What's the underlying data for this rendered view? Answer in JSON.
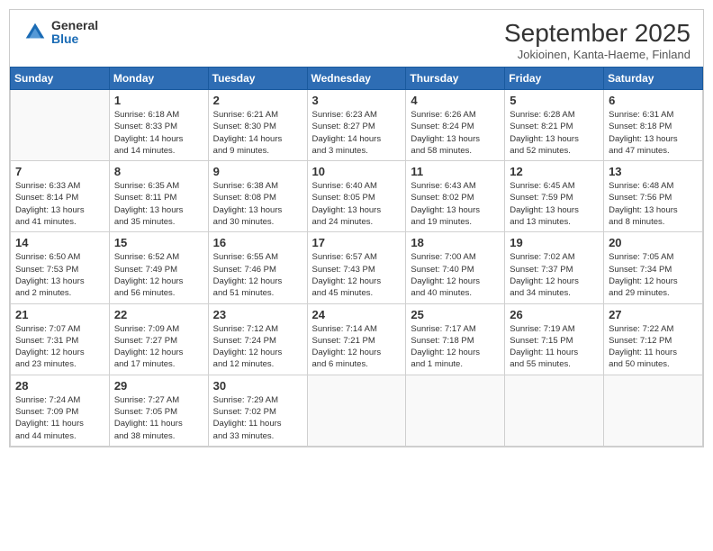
{
  "header": {
    "logo": {
      "general": "General",
      "blue": "Blue"
    },
    "title": "September 2025",
    "location": "Jokioinen, Kanta-Haeme, Finland"
  },
  "weekdays": [
    "Sunday",
    "Monday",
    "Tuesday",
    "Wednesday",
    "Thursday",
    "Friday",
    "Saturday"
  ],
  "weeks": [
    [
      {
        "day": "",
        "info": ""
      },
      {
        "day": "1",
        "info": "Sunrise: 6:18 AM\nSunset: 8:33 PM\nDaylight: 14 hours\nand 14 minutes."
      },
      {
        "day": "2",
        "info": "Sunrise: 6:21 AM\nSunset: 8:30 PM\nDaylight: 14 hours\nand 9 minutes."
      },
      {
        "day": "3",
        "info": "Sunrise: 6:23 AM\nSunset: 8:27 PM\nDaylight: 14 hours\nand 3 minutes."
      },
      {
        "day": "4",
        "info": "Sunrise: 6:26 AM\nSunset: 8:24 PM\nDaylight: 13 hours\nand 58 minutes."
      },
      {
        "day": "5",
        "info": "Sunrise: 6:28 AM\nSunset: 8:21 PM\nDaylight: 13 hours\nand 52 minutes."
      },
      {
        "day": "6",
        "info": "Sunrise: 6:31 AM\nSunset: 8:18 PM\nDaylight: 13 hours\nand 47 minutes."
      }
    ],
    [
      {
        "day": "7",
        "info": "Sunrise: 6:33 AM\nSunset: 8:14 PM\nDaylight: 13 hours\nand 41 minutes."
      },
      {
        "day": "8",
        "info": "Sunrise: 6:35 AM\nSunset: 8:11 PM\nDaylight: 13 hours\nand 35 minutes."
      },
      {
        "day": "9",
        "info": "Sunrise: 6:38 AM\nSunset: 8:08 PM\nDaylight: 13 hours\nand 30 minutes."
      },
      {
        "day": "10",
        "info": "Sunrise: 6:40 AM\nSunset: 8:05 PM\nDaylight: 13 hours\nand 24 minutes."
      },
      {
        "day": "11",
        "info": "Sunrise: 6:43 AM\nSunset: 8:02 PM\nDaylight: 13 hours\nand 19 minutes."
      },
      {
        "day": "12",
        "info": "Sunrise: 6:45 AM\nSunset: 7:59 PM\nDaylight: 13 hours\nand 13 minutes."
      },
      {
        "day": "13",
        "info": "Sunrise: 6:48 AM\nSunset: 7:56 PM\nDaylight: 13 hours\nand 8 minutes."
      }
    ],
    [
      {
        "day": "14",
        "info": "Sunrise: 6:50 AM\nSunset: 7:53 PM\nDaylight: 13 hours\nand 2 minutes."
      },
      {
        "day": "15",
        "info": "Sunrise: 6:52 AM\nSunset: 7:49 PM\nDaylight: 12 hours\nand 56 minutes."
      },
      {
        "day": "16",
        "info": "Sunrise: 6:55 AM\nSunset: 7:46 PM\nDaylight: 12 hours\nand 51 minutes."
      },
      {
        "day": "17",
        "info": "Sunrise: 6:57 AM\nSunset: 7:43 PM\nDaylight: 12 hours\nand 45 minutes."
      },
      {
        "day": "18",
        "info": "Sunrise: 7:00 AM\nSunset: 7:40 PM\nDaylight: 12 hours\nand 40 minutes."
      },
      {
        "day": "19",
        "info": "Sunrise: 7:02 AM\nSunset: 7:37 PM\nDaylight: 12 hours\nand 34 minutes."
      },
      {
        "day": "20",
        "info": "Sunrise: 7:05 AM\nSunset: 7:34 PM\nDaylight: 12 hours\nand 29 minutes."
      }
    ],
    [
      {
        "day": "21",
        "info": "Sunrise: 7:07 AM\nSunset: 7:31 PM\nDaylight: 12 hours\nand 23 minutes."
      },
      {
        "day": "22",
        "info": "Sunrise: 7:09 AM\nSunset: 7:27 PM\nDaylight: 12 hours\nand 17 minutes."
      },
      {
        "day": "23",
        "info": "Sunrise: 7:12 AM\nSunset: 7:24 PM\nDaylight: 12 hours\nand 12 minutes."
      },
      {
        "day": "24",
        "info": "Sunrise: 7:14 AM\nSunset: 7:21 PM\nDaylight: 12 hours\nand 6 minutes."
      },
      {
        "day": "25",
        "info": "Sunrise: 7:17 AM\nSunset: 7:18 PM\nDaylight: 12 hours\nand 1 minute."
      },
      {
        "day": "26",
        "info": "Sunrise: 7:19 AM\nSunset: 7:15 PM\nDaylight: 11 hours\nand 55 minutes."
      },
      {
        "day": "27",
        "info": "Sunrise: 7:22 AM\nSunset: 7:12 PM\nDaylight: 11 hours\nand 50 minutes."
      }
    ],
    [
      {
        "day": "28",
        "info": "Sunrise: 7:24 AM\nSunset: 7:09 PM\nDaylight: 11 hours\nand 44 minutes."
      },
      {
        "day": "29",
        "info": "Sunrise: 7:27 AM\nSunset: 7:05 PM\nDaylight: 11 hours\nand 38 minutes."
      },
      {
        "day": "30",
        "info": "Sunrise: 7:29 AM\nSunset: 7:02 PM\nDaylight: 11 hours\nand 33 minutes."
      },
      {
        "day": "",
        "info": ""
      },
      {
        "day": "",
        "info": ""
      },
      {
        "day": "",
        "info": ""
      },
      {
        "day": "",
        "info": ""
      }
    ]
  ]
}
